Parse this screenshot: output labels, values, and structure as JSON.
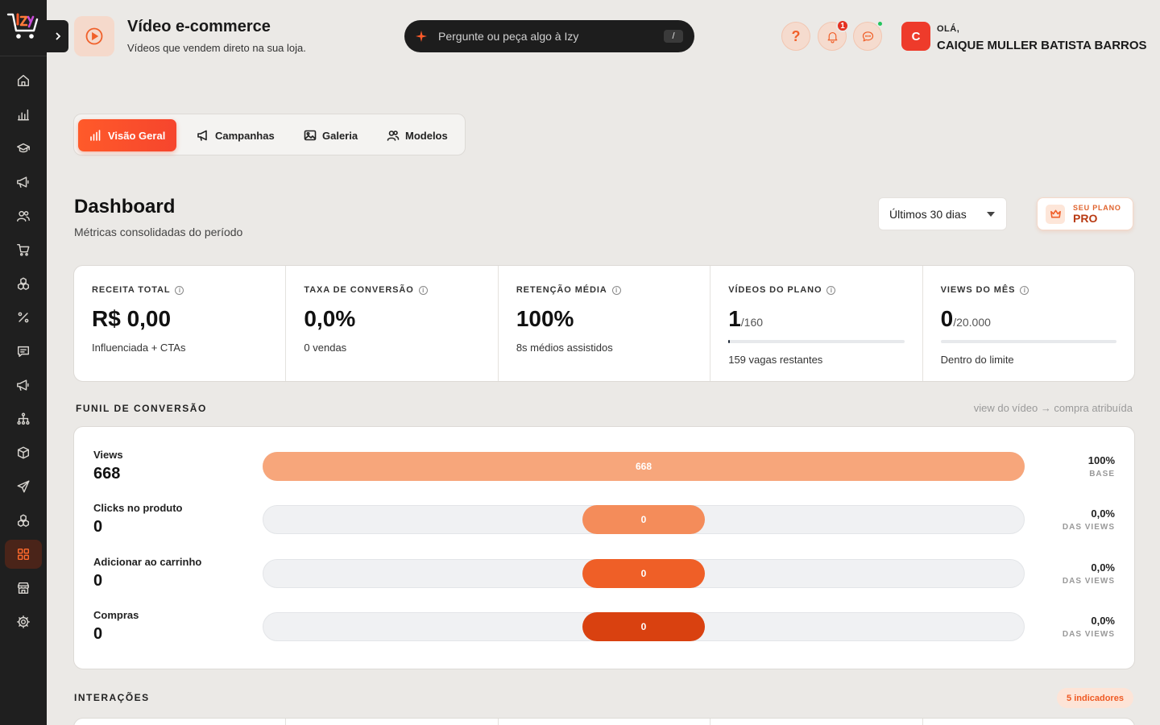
{
  "header": {
    "title": "Vídeo e-commerce",
    "subtitle": "Vídeos que vendem direto na sua loja.",
    "ask_placeholder": "Pergunte ou peça algo à Izy",
    "ask_shortcut": "/",
    "help_label": "?",
    "notifications_count": "1",
    "greeting": "OLÁ,",
    "user_name": "CAIQUE MULLER BATISTA BARROS",
    "avatar_initial": "C"
  },
  "sidebar": {
    "items": [
      {
        "icon": "home-icon"
      },
      {
        "icon": "bar-chart-icon"
      },
      {
        "icon": "graduation-cap-icon"
      },
      {
        "icon": "megaphone-icon"
      },
      {
        "icon": "users-icon"
      },
      {
        "icon": "cart-icon"
      },
      {
        "icon": "boxes-icon"
      },
      {
        "icon": "percent-icon"
      },
      {
        "icon": "message-square-icon"
      },
      {
        "icon": "megaphone-icon"
      },
      {
        "icon": "network-icon"
      },
      {
        "icon": "package-icon"
      },
      {
        "icon": "send-icon"
      },
      {
        "icon": "boxes-icon"
      },
      {
        "icon": "grid-icon",
        "active": true
      },
      {
        "icon": "store-icon"
      },
      {
        "icon": "settings-icon"
      }
    ]
  },
  "tabs": [
    {
      "label": "Visão Geral",
      "icon": "bar-chart-icon",
      "active": true
    },
    {
      "label": "Campanhas",
      "icon": "megaphone-icon"
    },
    {
      "label": "Galeria",
      "icon": "image-icon"
    },
    {
      "label": "Modelos",
      "icon": "users-icon"
    }
  ],
  "dashboard": {
    "title": "Dashboard",
    "subtitle": "Métricas consolidadas do período",
    "period": "Últimos 30 dias",
    "plan_label": "SEU PLANO",
    "plan_name": "PRO"
  },
  "metrics": [
    {
      "label": "RECEITA TOTAL",
      "value": "R$ 0,00",
      "suffix": "",
      "note": "Influenciada + CTAs"
    },
    {
      "label": "TAXA DE CONVERSÃO",
      "value": "0,0%",
      "suffix": "",
      "note": "0 vendas"
    },
    {
      "label": "RETENÇÃO MÉDIA",
      "value": "100%",
      "suffix": "",
      "note": "8s médios assistidos"
    },
    {
      "label": "VÍDEOS DO PLANO",
      "value": "1",
      "suffix": "/160",
      "note": "159 vagas restantes",
      "progress": 0.00625
    },
    {
      "label": "VIEWS DO MÊS",
      "value": "0",
      "suffix": "/20.000",
      "note": "Dentro do limite",
      "progress": 0
    }
  ],
  "funnel": {
    "title": "FUNIL DE CONVERSÃO",
    "hint": "view do vídeo → compra atribuída",
    "stages": [
      {
        "name": "Views",
        "count": "668",
        "bar_label": "668",
        "pct": "100%",
        "pct_sub": "BASE",
        "fraction": 1.0,
        "color": "#f7a67b"
      },
      {
        "name": "Clicks no produto",
        "count": "0",
        "bar_label": "0",
        "pct": "0,0%",
        "pct_sub": "DAS VIEWS",
        "fraction": 0,
        "color": "#f48c5a"
      },
      {
        "name": "Adicionar ao carrinho",
        "count": "0",
        "bar_label": "0",
        "pct": "0,0%",
        "pct_sub": "DAS VIEWS",
        "fraction": 0,
        "color": "#ef5f27"
      },
      {
        "name": "Compras",
        "count": "0",
        "bar_label": "0",
        "pct": "0,0%",
        "pct_sub": "DAS VIEWS",
        "fraction": 0,
        "color": "#d94110"
      }
    ]
  },
  "interactions": {
    "title": "INTERAÇÕES",
    "badge": "5 indicadores"
  },
  "colors": {
    "accent": "#f0602a",
    "sidebar_bg": "#1f1f1f",
    "page_bg": "#ebe9e6"
  }
}
